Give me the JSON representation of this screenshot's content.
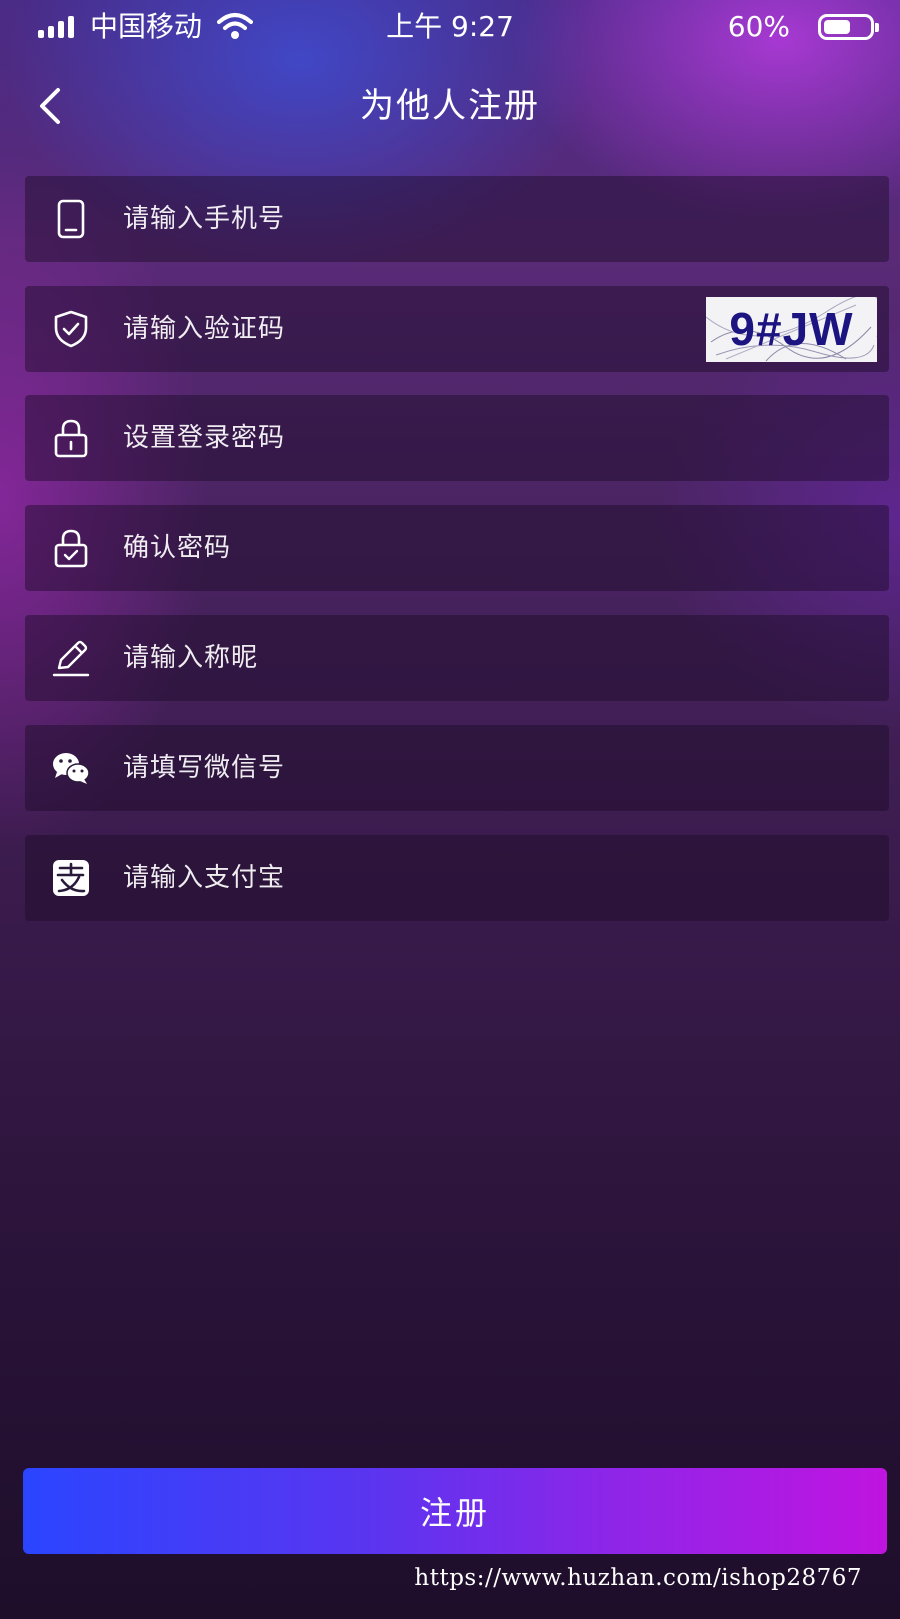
{
  "status_bar": {
    "carrier": "中国移动",
    "time": "上午 9:27",
    "battery_percent": "60%",
    "battery_level": 0.6
  },
  "nav": {
    "title": "为他人注册"
  },
  "form": {
    "phone_placeholder": "请输入手机号",
    "captcha_placeholder": "请输入验证码",
    "captcha_image_text": "9#JW",
    "password_placeholder": "设置登录密码",
    "confirm_password_placeholder": "确认密码",
    "nickname_placeholder": "请输入称昵",
    "wechat_placeholder": "请填写微信号",
    "alipay_placeholder": "请输入支付宝"
  },
  "submit": {
    "label": "注册"
  },
  "watermark": "https://www.huzhan.com/ishop28767",
  "colors": {
    "button_gradient_start": "#2b45ff",
    "button_gradient_end": "#c014e0",
    "captcha_text": "#1c1480"
  },
  "icons": {
    "phone": "phone-icon",
    "captcha": "shield-check-icon",
    "password": "lock-icon",
    "confirm_password": "lock-check-icon",
    "nickname": "pencil-icon",
    "wechat": "wechat-icon",
    "alipay": "alipay-icon"
  }
}
